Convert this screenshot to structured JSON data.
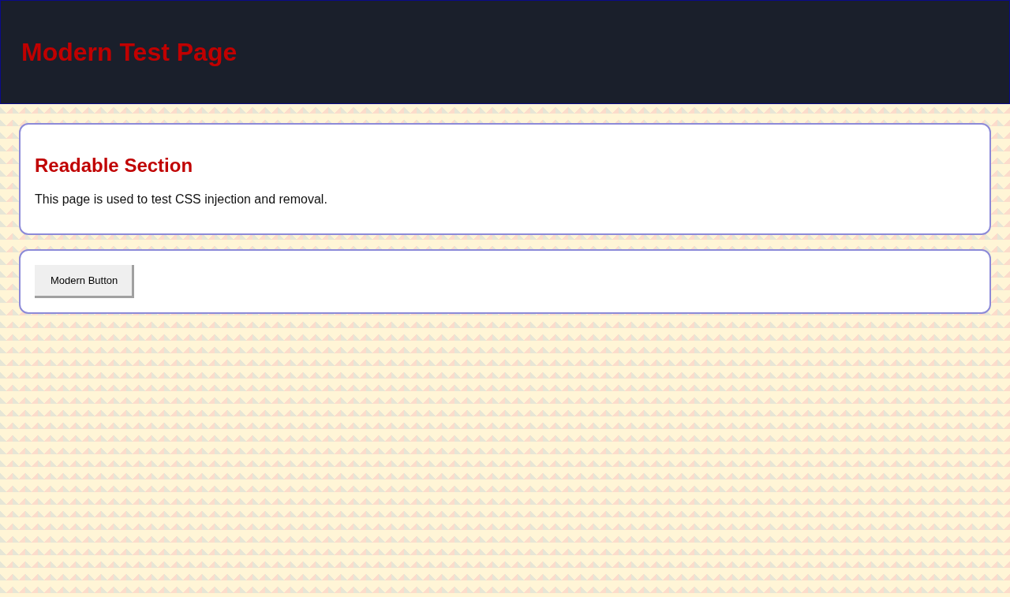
{
  "header": {
    "title": "Modern Test Page"
  },
  "sections": [
    {
      "kind": "text",
      "heading": "Readable Section",
      "text": "This page is used to test CSS injection and removal."
    },
    {
      "kind": "buttons",
      "buttons": [
        "Modern Button"
      ]
    }
  ]
}
